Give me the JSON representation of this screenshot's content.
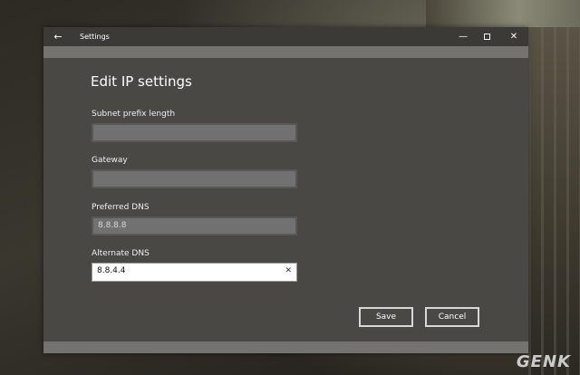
{
  "window": {
    "title": "Settings"
  },
  "page": {
    "heading": "Edit IP settings"
  },
  "fields": [
    {
      "label": "Subnet prefix length",
      "value": ""
    },
    {
      "label": "Gateway",
      "value": ""
    },
    {
      "label": "Preferred DNS",
      "value": "8.8.8.8"
    },
    {
      "label": "Alternate DNS",
      "value": "8.8.4.4"
    }
  ],
  "buttons": {
    "save": "Save",
    "cancel": "Cancel"
  },
  "icons": {
    "back": "back-arrow-icon",
    "minimize": "minimize-icon",
    "maximize": "maximize-icon",
    "close": "close-icon",
    "clear": "clear-x-icon"
  },
  "watermark": "GENK"
}
